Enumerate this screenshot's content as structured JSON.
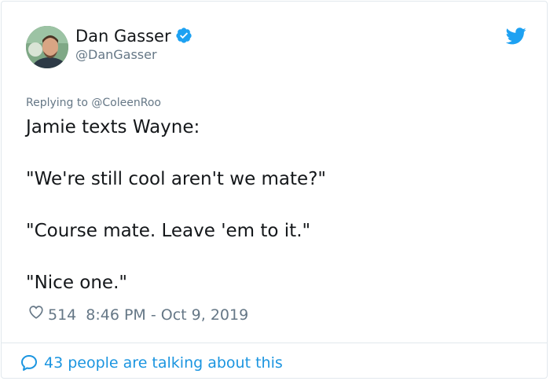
{
  "author": {
    "name": "Dan Gasser",
    "handle": "@DanGasser",
    "verified": true
  },
  "reply": {
    "prefix": "Replying to",
    "mention": "@ColeenRoo"
  },
  "tweet": {
    "lines": [
      "Jamie texts Wayne:",
      "\"We're still cool aren't we mate?\"",
      "\"Course mate. Leave 'em to it.\"",
      "\"Nice one.\""
    ]
  },
  "meta": {
    "likes": "514",
    "timestamp": "8:46 PM - Oct 9, 2019"
  },
  "footer": {
    "talking": "43 people are talking about this"
  },
  "icons": {
    "verified": "verified-badge-icon",
    "bird": "twitter-bird-icon",
    "heart": "heart-icon",
    "comment": "comment-bubble-icon"
  },
  "colors": {
    "brand": "#1da1f2",
    "link": "#1b95e0",
    "muted": "#657786",
    "text": "#14171a"
  }
}
